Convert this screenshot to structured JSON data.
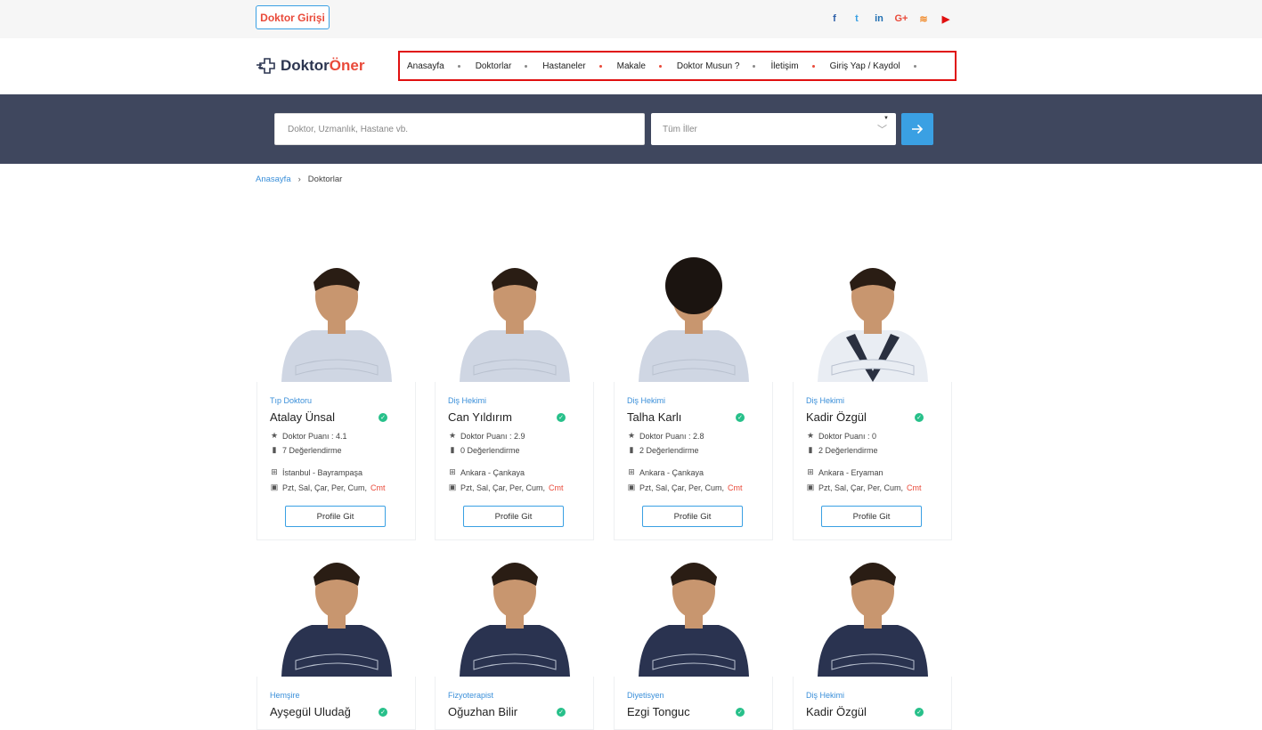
{
  "topbar": {
    "doctor_login": "Doktor Girişi",
    "social": [
      {
        "icon": "facebook-icon",
        "glyph": "f",
        "color": "#2d5fa8"
      },
      {
        "icon": "twitter-icon",
        "glyph": "t",
        "color": "#3aa0e3"
      },
      {
        "icon": "linkedin-icon",
        "glyph": "in",
        "color": "#1f6fb2"
      },
      {
        "icon": "google-plus-icon",
        "glyph": "G+",
        "color": "#e94a3a"
      },
      {
        "icon": "rss-icon",
        "glyph": "≋",
        "color": "#f08a2a"
      },
      {
        "icon": "youtube-icon",
        "glyph": "▶",
        "color": "#e01010"
      }
    ]
  },
  "logo": {
    "part1": "Doktor",
    "part2": "Öner"
  },
  "nav": {
    "items": [
      {
        "label": "Anasayfa",
        "dot": "#888"
      },
      {
        "label": "Doktorlar",
        "dot": "#888"
      },
      {
        "label": "Hastaneler",
        "dot": "#e94a3a"
      },
      {
        "label": "Makale",
        "dot": "#e94a3a"
      },
      {
        "label": "Doktor Musun ?",
        "dot": "#888"
      },
      {
        "label": "İletişim",
        "dot": "#e94a3a"
      },
      {
        "label": "Giriş Yap / Kaydol",
        "dot": "#888"
      }
    ]
  },
  "search": {
    "placeholder": "Doktor, Uzmanlık, Hastane vb.",
    "city_select": "Tüm İller"
  },
  "breadcrumb": {
    "home": "Anasayfa",
    "current": "Doktorlar"
  },
  "profile_button": "Profile Git",
  "doctors": [
    {
      "specialty": "Tıp Doktoru",
      "name": "Atalay Ünsal",
      "rating": "Doktor Puanı : 4.1",
      "reviews": "7 Değerlendirme",
      "location": "İstanbul - Bayrampaşa",
      "days": "Pzt, Sal, Çar, Per, Cum,",
      "days_extra": "Cmt"
    },
    {
      "specialty": "Diş Hekimi",
      "name": "Can Yıldırım",
      "rating": "Doktor Puanı : 2.9",
      "reviews": "0 Değerlendirme",
      "location": "Ankara - Çankaya",
      "days": "Pzt, Sal, Çar, Per, Cum,",
      "days_extra": "Cmt"
    },
    {
      "specialty": "Diş Hekimi",
      "name": "Talha Karlı",
      "rating": "Doktor Puanı : 2.8",
      "reviews": "2 Değerlendirme",
      "location": "Ankara - Çankaya",
      "days": "Pzt, Sal, Çar, Per, Cum,",
      "days_extra": "Cmt"
    },
    {
      "specialty": "Diş Hekimi",
      "name": "Kadir Özgül",
      "rating": "Doktor Puanı : 0",
      "reviews": "2 Değerlendirme",
      "location": "Ankara - Eryaman",
      "days": "Pzt, Sal, Çar, Per, Cum,",
      "days_extra": "Cmt"
    },
    {
      "specialty": "Hemşire",
      "name": "Ayşegül Uludağ"
    },
    {
      "specialty": "Fizyoterapist",
      "name": "Oğuzhan Bilir"
    },
    {
      "specialty": "Diyetisyen",
      "name": "Ezgi Tonguc"
    },
    {
      "specialty": "Diş Hekimi",
      "name": "Kadir Özgül"
    }
  ]
}
